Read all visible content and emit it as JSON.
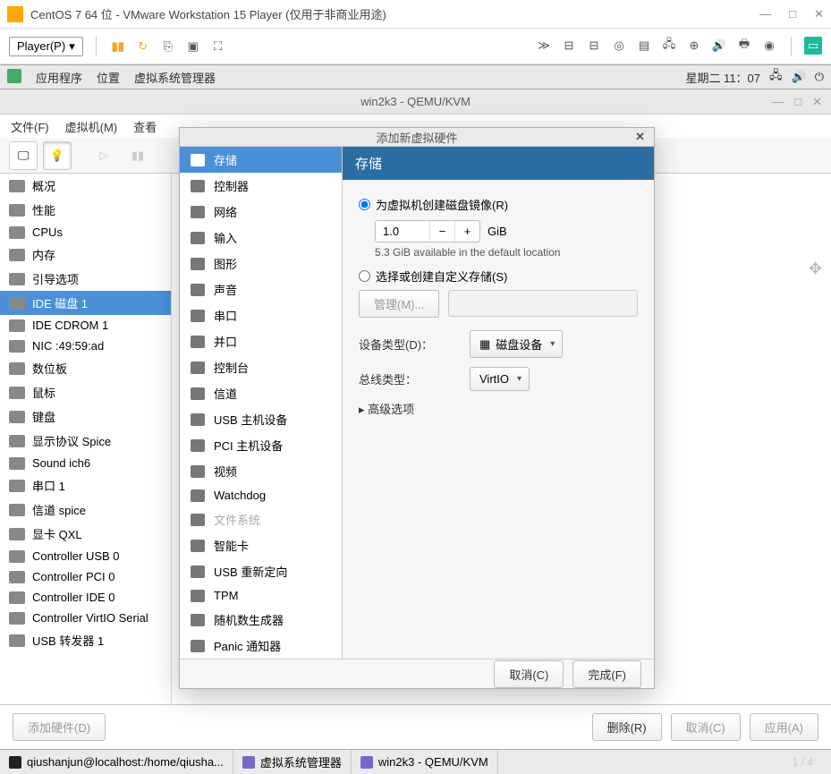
{
  "vmware": {
    "title": "CentOS 7 64 位 - VMware Workstation 15 Player (仅用于非商业用途)",
    "player_menu": "Player(P)"
  },
  "gnome": {
    "apps": "应用程序",
    "places": "位置",
    "active_app": "虚拟系统管理器",
    "clock": "星期二 11：07"
  },
  "vmm": {
    "title": "win2k3 - QEMU/KVM",
    "menu": {
      "file": "文件(F)",
      "vm": "虚拟机(M)",
      "view": "查看"
    },
    "devices": [
      "概况",
      "性能",
      "CPUs",
      "内存",
      "引导选项",
      "IDE 磁盘 1",
      "IDE CDROM 1",
      "NIC :49:59:ad",
      "数位板",
      "鼠标",
      "键盘",
      "显示协议 Spice",
      "Sound ich6",
      "串口 1",
      "信道 spice",
      "显卡 QXL",
      "Controller USB 0",
      "Controller PCI 0",
      "Controller IDE 0",
      "Controller VirtIO Serial",
      "USB 转发器 1"
    ],
    "selected_device_index": 5,
    "add_hw": "添加硬件(D)",
    "remove": "删除(R)",
    "cancel": "取消(C)",
    "apply": "应用(A)"
  },
  "modal": {
    "title": "添加新虚拟硬件",
    "categories": [
      "存储",
      "控制器",
      "网络",
      "输入",
      "图形",
      "声音",
      "串口",
      "并口",
      "控制台",
      "信道",
      "USB 主机设备",
      "PCI 主机设备",
      "视频",
      "Watchdog",
      "文件系统",
      "智能卡",
      "USB 重新定向",
      "TPM",
      "随机数生成器",
      "Panic 通知器"
    ],
    "selected_category_index": 0,
    "disabled_category_index": 14,
    "pane": {
      "heading": "存储",
      "radio_create": "为虚拟机创建磁盘镜像(R)",
      "size_value": "1.0",
      "size_unit": "GiB",
      "avail_hint": "5.3 GiB available in the default location",
      "radio_custom": "选择或创建自定义存储(S)",
      "manage_btn": "管理(M)...",
      "device_type_label": "设备类型(D)：",
      "device_type_value": "磁盘设备",
      "bus_type_label": "总线类型：",
      "bus_type_value": "VirtIO",
      "advanced": "高级选项"
    },
    "cancel": "取消(C)",
    "finish": "完成(F)"
  },
  "taskbar": {
    "task1": "qiushanjun@localhost:/home/qiusha...",
    "task2": "虚拟系统管理器",
    "task3": "win2k3 - QEMU/KVM"
  },
  "watermark": "1 / 4"
}
